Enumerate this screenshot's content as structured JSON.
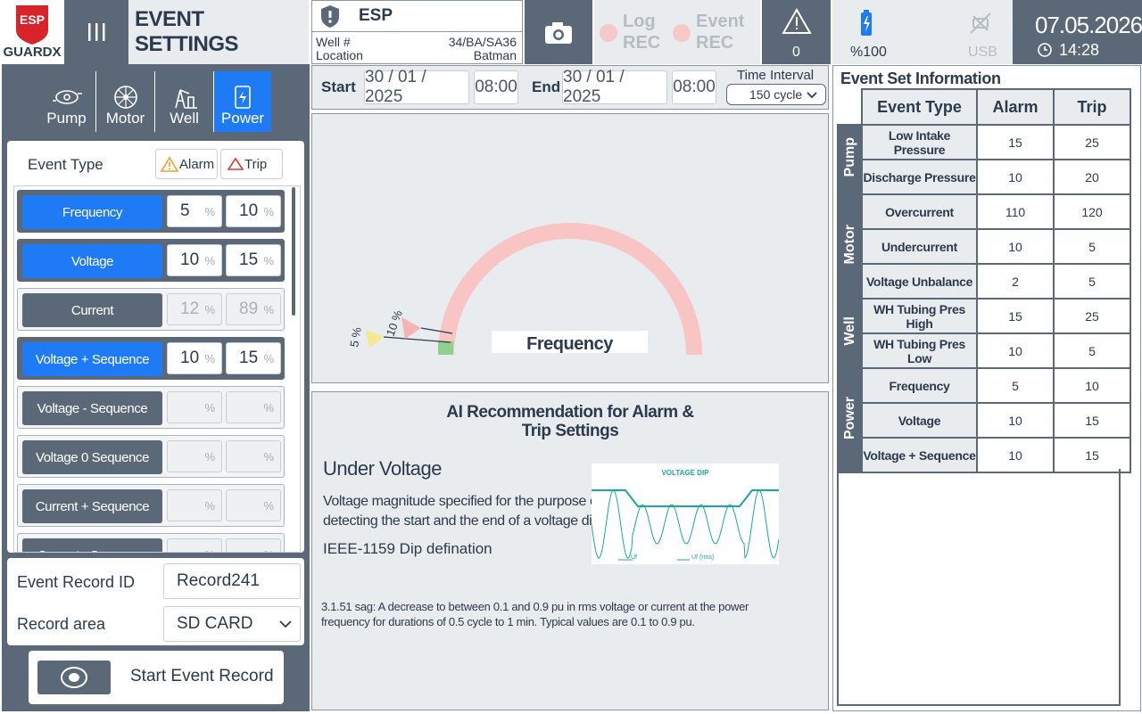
{
  "brand": {
    "badge": "ESP",
    "name": "GUARDX"
  },
  "header": {
    "title": "EVENT SETTINGS"
  },
  "device": {
    "name": "ESP",
    "well_label": "Well #",
    "well_value": "34/BA/SA36",
    "location_label": "Location",
    "location_value": "Batman"
  },
  "rec": {
    "log_line1": "Log",
    "log_line2": "REC",
    "event_line1": "Event",
    "event_line2": "REC"
  },
  "alerts": {
    "count": "0"
  },
  "status": {
    "battery": "%100",
    "usb": "USB",
    "date": "07.05.2026",
    "time": "14:28"
  },
  "categories": [
    {
      "label": "Pump",
      "icon": "pump-icon",
      "active": false
    },
    {
      "label": "Motor",
      "icon": "motor-icon",
      "active": false
    },
    {
      "label": "Well",
      "icon": "well-icon",
      "active": false
    },
    {
      "label": "Power",
      "icon": "power-icon",
      "active": true
    }
  ],
  "event_type": {
    "label": "Event Type",
    "alarm": "Alarm",
    "trip": "Trip"
  },
  "events": [
    {
      "label": "Frequency",
      "alarm": "5",
      "trip": "10",
      "unit": "%",
      "state": "on"
    },
    {
      "label": "Voltage",
      "alarm": "10",
      "trip": "15",
      "unit": "%",
      "state": "on"
    },
    {
      "label": "Current",
      "alarm": "12",
      "trip": "89",
      "unit": "%",
      "state": "off"
    },
    {
      "label": "Voltage + Sequence",
      "alarm": "10",
      "trip": "15",
      "unit": "%",
      "state": "on"
    },
    {
      "label": "Voltage - Sequence",
      "alarm": "",
      "trip": "",
      "unit": "%",
      "state": "off"
    },
    {
      "label": "Voltage 0 Sequence",
      "alarm": "",
      "trip": "",
      "unit": "%",
      "state": "off"
    },
    {
      "label": "Current + Sequence",
      "alarm": "",
      "trip": "",
      "unit": "%",
      "state": "off"
    },
    {
      "label": "Current - Sequence",
      "alarm": "",
      "trip": "",
      "unit": "%",
      "state": "off"
    }
  ],
  "record": {
    "id_label": "Event Record ID",
    "id_value": "Record241",
    "area_label": "Record area",
    "area_value": "SD CARD",
    "start_label": "Start Event Record"
  },
  "datebar": {
    "start_label": "Start",
    "start_date": "30 / 01 / 2025",
    "start_time": "08:00",
    "end_label": "End",
    "end_date": "30 / 01 / 2025",
    "end_time": "08:00",
    "interval_label": "Time Interval",
    "interval_value": "150 cycle"
  },
  "gauge": {
    "label": "Frequency",
    "alarm_marker": "5 %",
    "trip_marker": "10 %",
    "alarm_value": 5,
    "trip_value": 10,
    "colors": {
      "arc": "#f8c4c4",
      "alarm": "#f4e98c",
      "trip": "#f7b3b3",
      "ok": "#8ed08e"
    }
  },
  "ai": {
    "title_line1": "AI Recommendation for Alarm &",
    "title_line2": "Trip Settings",
    "heading": "Under Voltage",
    "desc_line1": "Voltage magnitude specified for the purpose of",
    "desc_line2": "detecting the start and the end of a voltage  dip",
    "standard": "IEEE-1159 Dip defination",
    "chart_title": "VOLTAGE DIP",
    "legend1": "Uf",
    "legend2": "Uf (rms)",
    "note_line1": "3.1.51 sag: A decrease to between 0.1 and 0.9 pu in rms voltage or current at the power",
    "note_line2": "frequency for durations of 0.5 cycle to 1 min. Typical values are 0.1 to 0.9 pu."
  },
  "info": {
    "title": "Event Set Information",
    "headers": [
      "Event Type",
      "Alarm",
      "Trip"
    ],
    "groups": [
      {
        "name": "Pump",
        "rows": [
          {
            "type": "Low Intake Pressure",
            "alarm": "15",
            "trip": "25"
          },
          {
            "type": "Discharge Pressure",
            "alarm": "10",
            "trip": "20"
          }
        ]
      },
      {
        "name": "Motor",
        "rows": [
          {
            "type": "Overcurrent",
            "alarm": "110",
            "trip": "120"
          },
          {
            "type": "Undercurrent",
            "alarm": "10",
            "trip": "5"
          },
          {
            "type": "Voltage Unbalance",
            "alarm": "2",
            "trip": "5"
          }
        ]
      },
      {
        "name": "Well",
        "rows": [
          {
            "type": "WH Tubing Pres High",
            "alarm": "15",
            "trip": "25"
          },
          {
            "type": "WH Tubing Pres Low",
            "alarm": "10",
            "trip": "5"
          }
        ]
      },
      {
        "name": "Power",
        "rows": [
          {
            "type": "Frequency",
            "alarm": "5",
            "trip": "10"
          },
          {
            "type": "Voltage",
            "alarm": "10",
            "trip": "15"
          },
          {
            "type": "Voltage + Sequence",
            "alarm": "10",
            "trip": "15"
          }
        ]
      }
    ]
  }
}
